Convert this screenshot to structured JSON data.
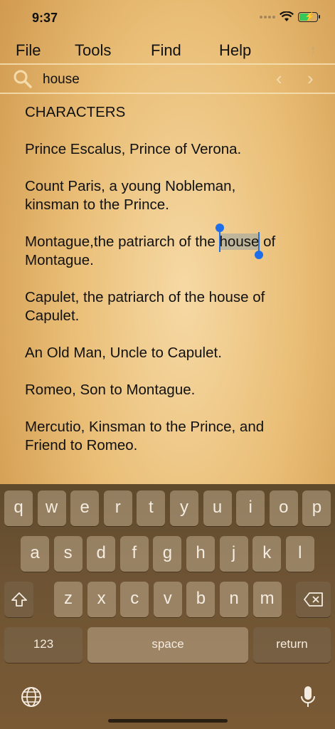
{
  "status": {
    "time": "9:37"
  },
  "menu": {
    "file": "File",
    "tools": "Tools",
    "find": "Find",
    "help": "Help"
  },
  "search": {
    "query": "house"
  },
  "document": {
    "heading": "CHARACTERS",
    "p1": "Prince Escalus, Prince of Verona.",
    "p2_l1": "Count Paris, a young Nobleman,",
    "p2_l2": "kinsman to the Prince.",
    "p3_pre": "Montague,the patriarch of the ",
    "p3_match": "house",
    "p3_post": " of",
    "p3_l2": "Montague.",
    "p4_l1": "Capulet, the patriarch of the house of",
    "p4_l2": "Capulet.",
    "p5": "An Old Man, Uncle to Capulet.",
    "p6": "Romeo, Son to Montague.",
    "p7_l1": "Mercutio, Kinsman to the Prince, and",
    "p7_l2": "Friend to Romeo."
  },
  "keyboard": {
    "row1": [
      "q",
      "w",
      "e",
      "r",
      "t",
      "y",
      "u",
      "i",
      "o",
      "p"
    ],
    "row2": [
      "a",
      "s",
      "d",
      "f",
      "g",
      "h",
      "j",
      "k",
      "l"
    ],
    "row3": [
      "z",
      "x",
      "c",
      "v",
      "b",
      "n",
      "m"
    ],
    "numbers": "123",
    "space": "space",
    "return": "return"
  }
}
